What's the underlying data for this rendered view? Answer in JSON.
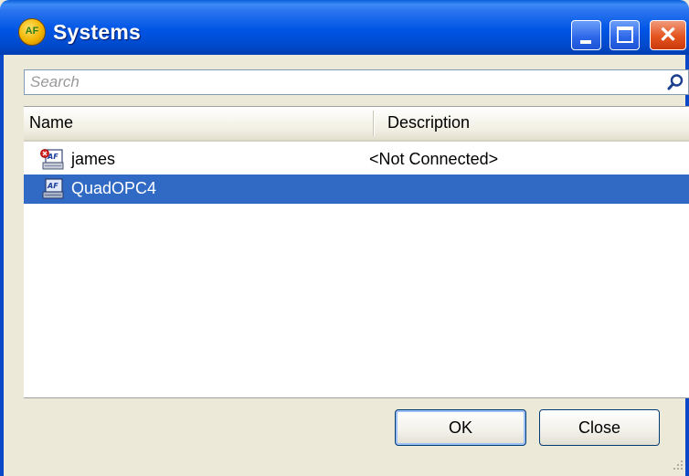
{
  "window": {
    "title": "Systems",
    "app_icon_text": "AF"
  },
  "search": {
    "placeholder": "Search"
  },
  "list": {
    "columns": [
      "Name",
      "Description"
    ],
    "rows": [
      {
        "name": "james",
        "description": "<Not Connected>",
        "status": "error",
        "selected": false
      },
      {
        "name": "QuadOPC4",
        "description": "",
        "status": "connected",
        "selected": true
      }
    ]
  },
  "buttons": {
    "ok": "OK",
    "close": "Close"
  },
  "colors": {
    "selection": "#316ac5",
    "titlebar": "#0055e5",
    "dialog_bg": "#ece9d8"
  }
}
